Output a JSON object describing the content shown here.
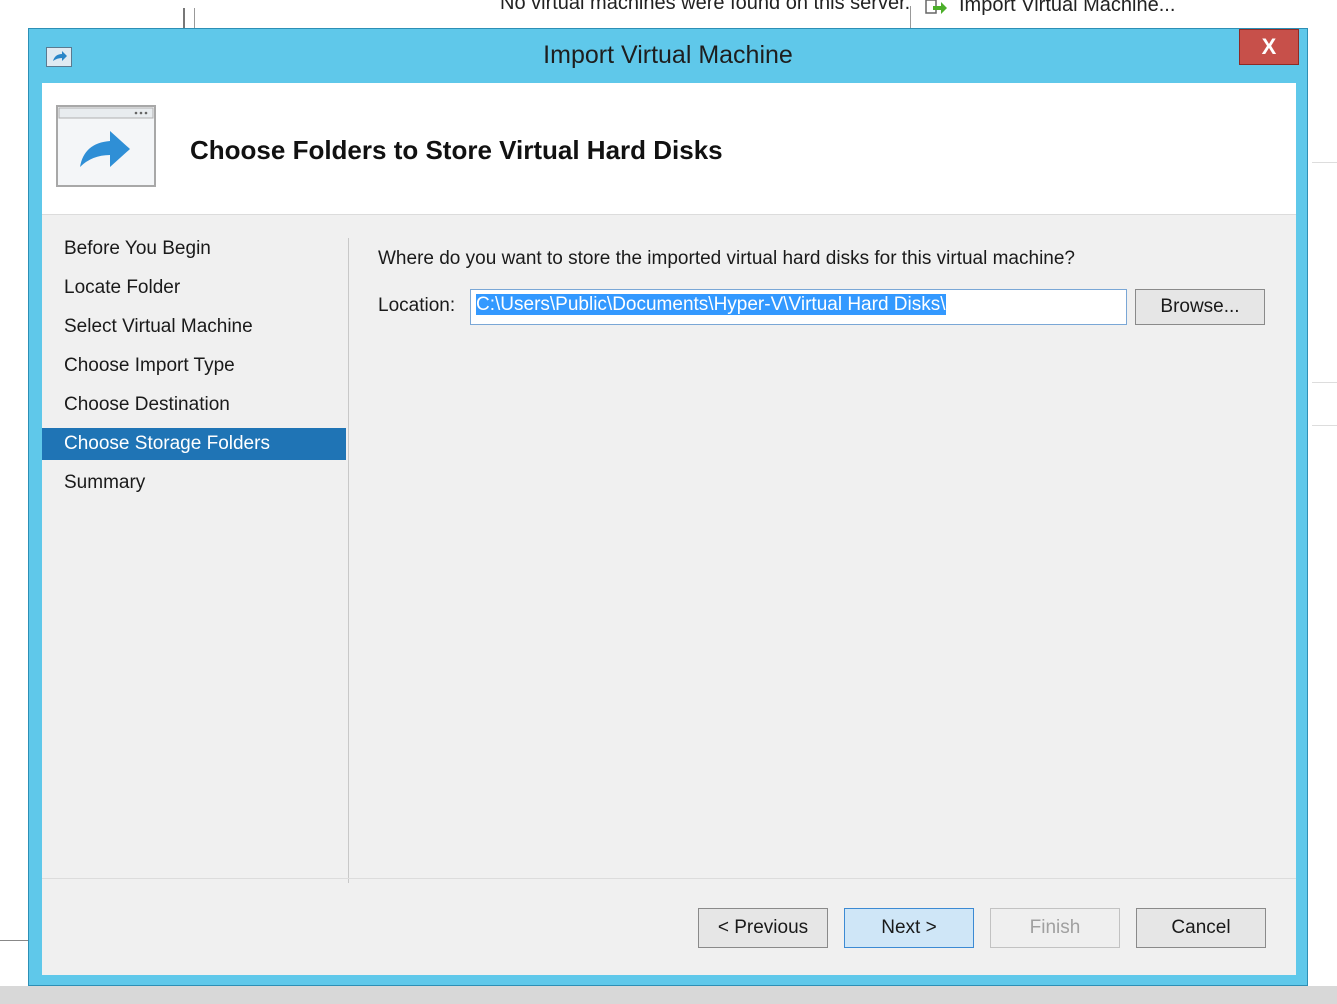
{
  "background": {
    "status_text": "No virtual machines were found on this server.",
    "action_label": "Import Virtual Machine..."
  },
  "dialog": {
    "title": "Import Virtual Machine",
    "close_label": "X",
    "heading": "Choose Folders to Store Virtual Hard Disks",
    "nav": [
      {
        "label": "Before You Begin",
        "active": false
      },
      {
        "label": "Locate Folder",
        "active": false
      },
      {
        "label": "Select Virtual Machine",
        "active": false
      },
      {
        "label": "Choose Import Type",
        "active": false
      },
      {
        "label": "Choose Destination",
        "active": false
      },
      {
        "label": "Choose Storage Folders",
        "active": true
      },
      {
        "label": "Summary",
        "active": false
      }
    ],
    "question": "Where do you want to store the imported virtual hard disks for this virtual machine?",
    "location_label": "Location:",
    "location_value": "C:\\Users\\Public\\Documents\\Hyper-V\\Virtual Hard Disks\\",
    "browse_label": "Browse...",
    "buttons": {
      "previous": "< Previous",
      "next": "Next >",
      "finish": "Finish",
      "cancel": "Cancel"
    }
  },
  "colors": {
    "frame": "#5fc8ea",
    "selection": "#1f74b5",
    "close": "#c7504a"
  }
}
